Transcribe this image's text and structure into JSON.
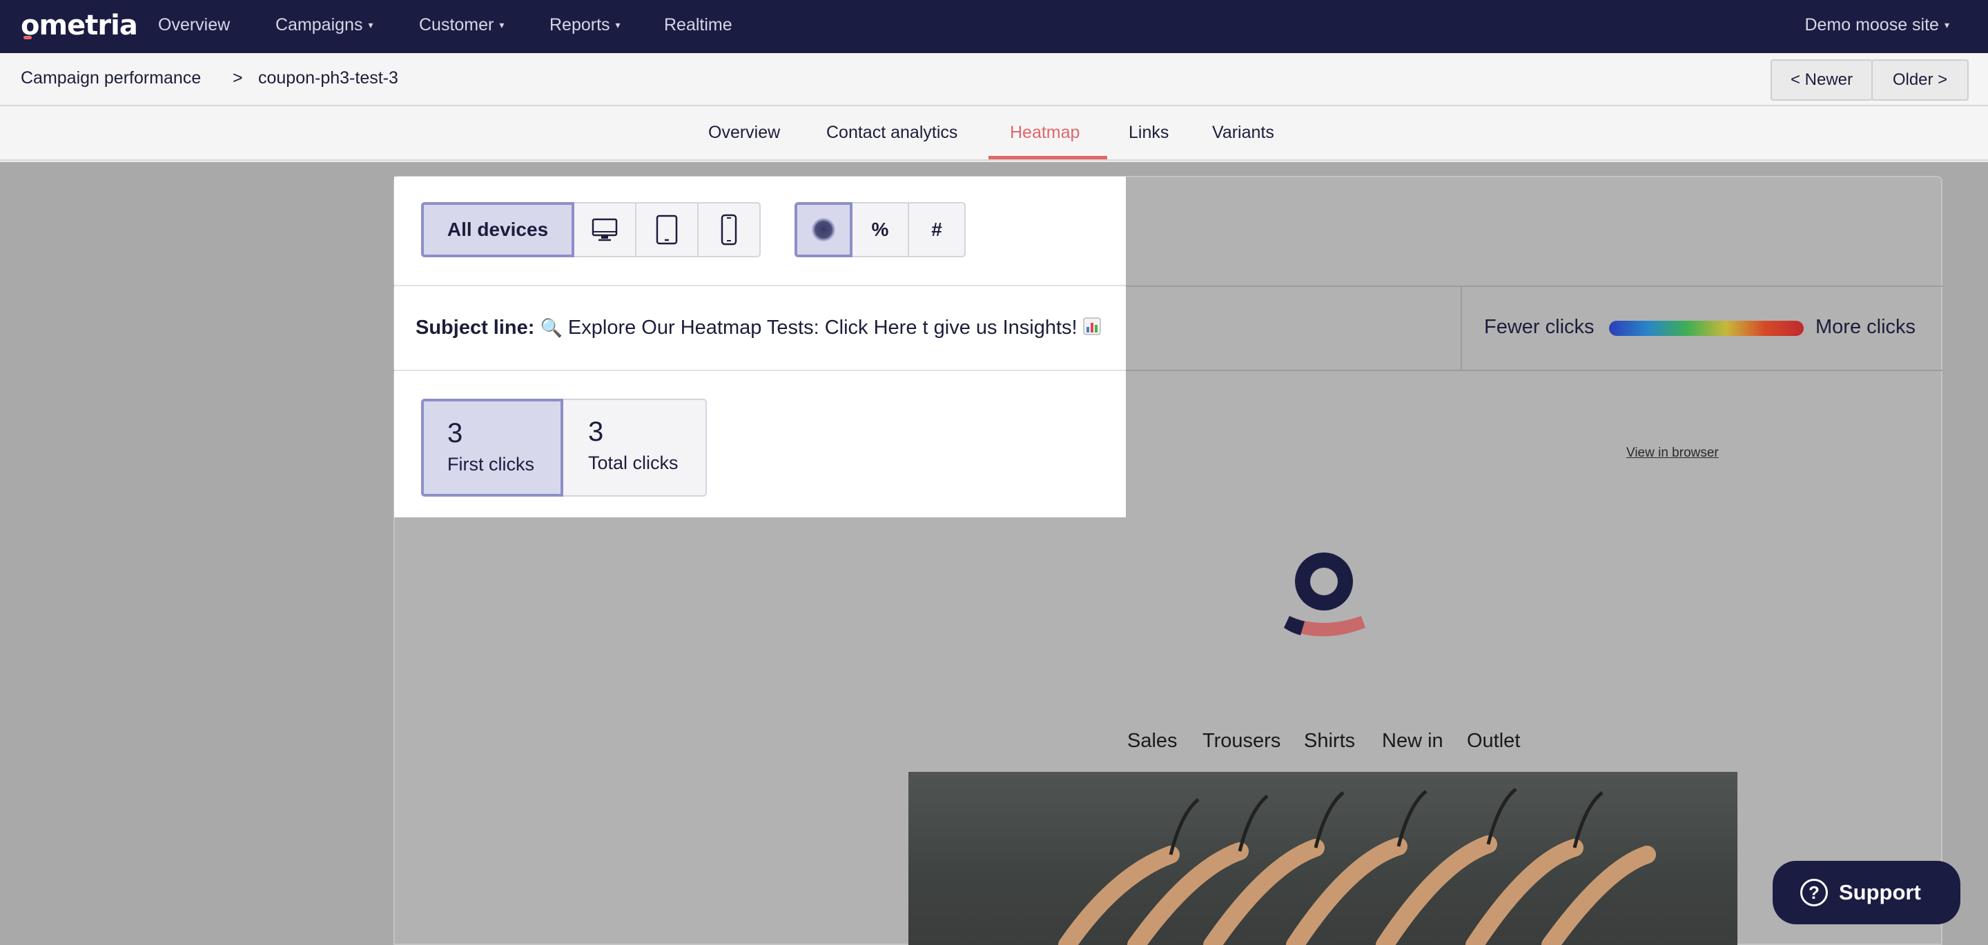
{
  "topnav": {
    "logo": "ometria",
    "items": [
      {
        "label": "Overview",
        "dropdown": false
      },
      {
        "label": "Campaigns",
        "dropdown": true
      },
      {
        "label": "Customer",
        "dropdown": true
      },
      {
        "label": "Reports",
        "dropdown": true
      },
      {
        "label": "Realtime",
        "dropdown": false
      }
    ],
    "site": "Demo moose site"
  },
  "breadcrumb": {
    "parent": "Campaign performance",
    "separator": ">",
    "current": "coupon-ph3-test-3"
  },
  "pager": {
    "newer": "< Newer",
    "older": "Older >"
  },
  "tabs": [
    {
      "label": "Overview",
      "active": false
    },
    {
      "label": "Contact analytics",
      "active": false
    },
    {
      "label": "Heatmap",
      "active": true
    },
    {
      "label": "Links",
      "active": false
    },
    {
      "label": "Variants",
      "active": false
    }
  ],
  "device_filter": {
    "all_label": "All devices",
    "icons": [
      "desktop-icon",
      "tablet-icon",
      "mobile-icon"
    ],
    "selected": "All devices"
  },
  "display_mode": {
    "options": [
      {
        "icon": "heat-dot-icon",
        "label": "",
        "active": true
      },
      {
        "icon": "",
        "label": "%",
        "active": false
      },
      {
        "icon": "",
        "label": "#",
        "active": false
      }
    ]
  },
  "subject": {
    "label": "Subject line:",
    "prefix_icon": "magnifier-emoji",
    "text": "Explore Our Heatmap Tests: Click Here t give us Insights!",
    "suffix_icon": "chart-emoji"
  },
  "legend": {
    "fewer": "Fewer clicks",
    "more": "More clicks"
  },
  "clicks": [
    {
      "value": "3",
      "label": "First clicks",
      "active": true
    },
    {
      "value": "3",
      "label": "Total clicks",
      "active": false
    }
  ],
  "email_preview": {
    "view_in_browser": "View in browser",
    "nav": [
      "Sales",
      "Trousers",
      "Shirts",
      "New in",
      "Outlet"
    ]
  },
  "support": {
    "label": "Support"
  },
  "colors": {
    "nav_bg": "#1b1c42",
    "accent": "#e0676a",
    "selected_border": "#8d8fc8",
    "selected_bg": "#d7d8ec"
  }
}
